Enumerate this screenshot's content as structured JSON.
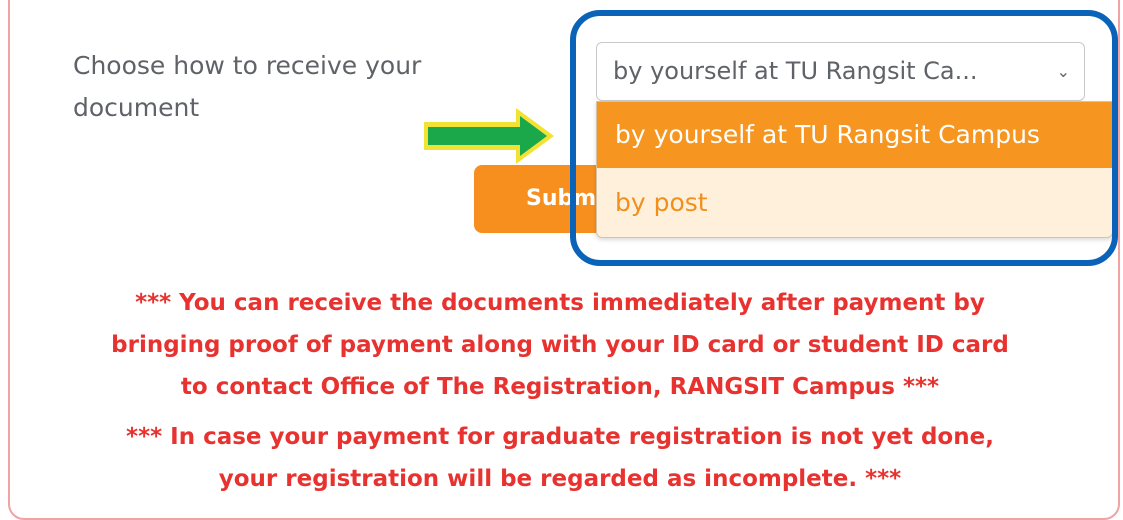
{
  "form": {
    "label_line1": "Choose how to receive your",
    "label_line2": "document",
    "select_value": "by yourself at TU Rangsit Ca...",
    "submit_label": "Submit",
    "options": [
      {
        "label": "by yourself at TU Rangsit Campus",
        "selected": true
      },
      {
        "label": "by post",
        "selected": false
      }
    ]
  },
  "notices": {
    "payment_lines": [
      "*** You can receive the documents immediately after payment by",
      "bringing proof of payment along with your ID card or student ID card",
      "to contact Office of The Registration, RANGSIT Campus ***"
    ],
    "incomplete_lines": [
      "*** In case your payment for graduate registration is not yet done,",
      "your registration will be regarded as incomplete. ***"
    ]
  },
  "icons": {
    "select_chevron": "chevron-down-icon",
    "pointer_arrow": "arrow-right-icon"
  },
  "colors": {
    "accent_orange": "#f6951f",
    "notice_red": "#e8322f",
    "highlight_blue": "#0a63b8",
    "arrow_green": "#1aa84b",
    "arrow_yellow": "#f2e234"
  }
}
